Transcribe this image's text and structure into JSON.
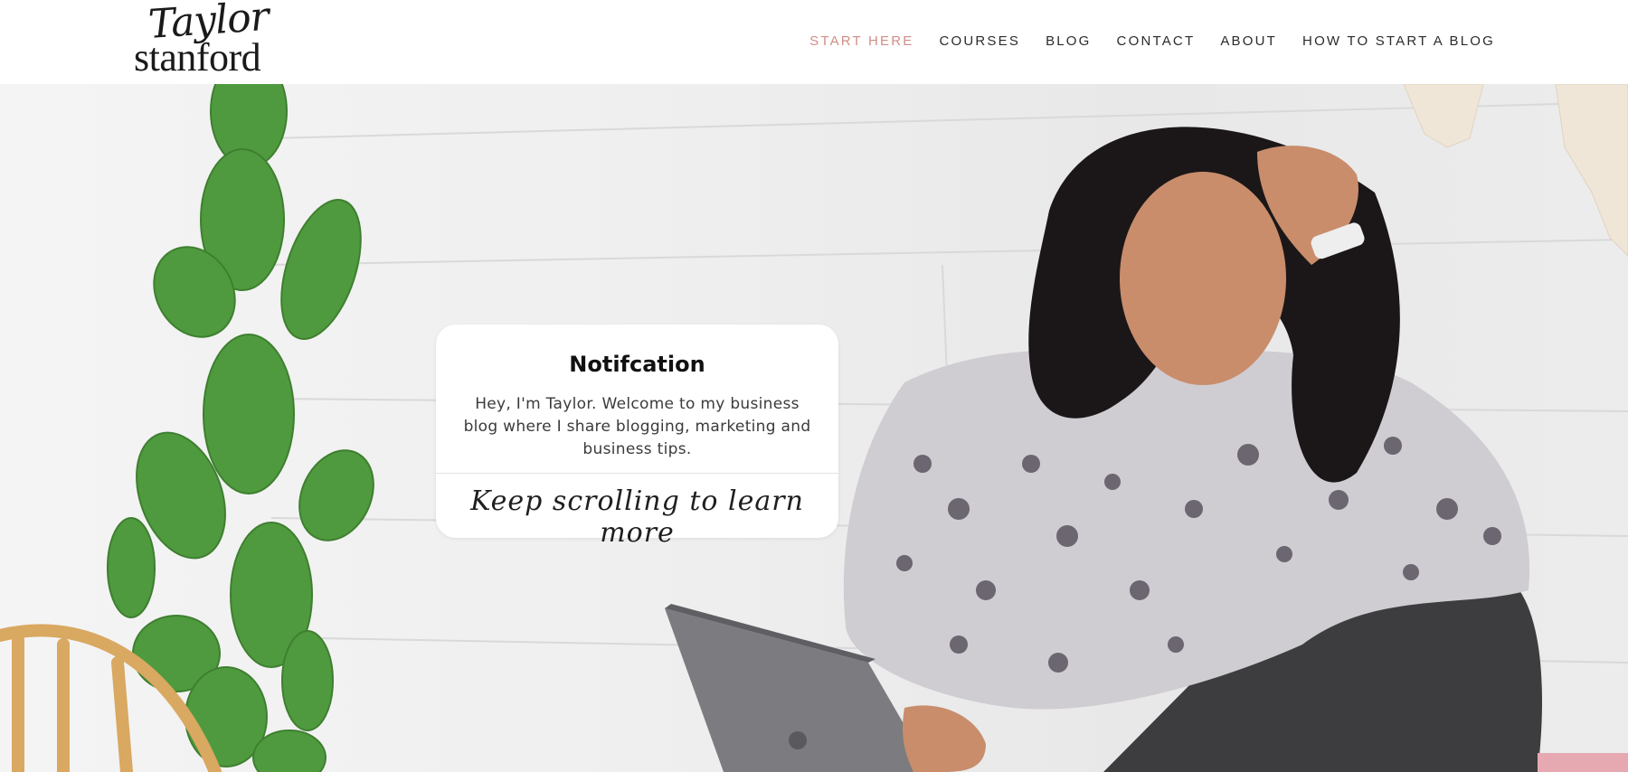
{
  "logo": {
    "script_text": "Taylor",
    "serif_text": "stanford"
  },
  "nav": {
    "items": [
      {
        "label": "START HERE",
        "active": true
      },
      {
        "label": "COURSES",
        "active": false
      },
      {
        "label": "BLOG",
        "active": false
      },
      {
        "label": "CONTACT",
        "active": false
      },
      {
        "label": "ABOUT",
        "active": false
      },
      {
        "label": "HOW TO START A BLOG",
        "active": false
      }
    ]
  },
  "notification": {
    "title": "Notifcation",
    "body": "Hey, I'm Taylor. Welcome to my business blog where I share blogging, marketing and business tips.",
    "cta": "Keep scrolling to learn more"
  },
  "colors": {
    "accent_nav": "#d08e86",
    "text_dark": "#2b2b2b",
    "cactus": "#4f9a3e"
  }
}
